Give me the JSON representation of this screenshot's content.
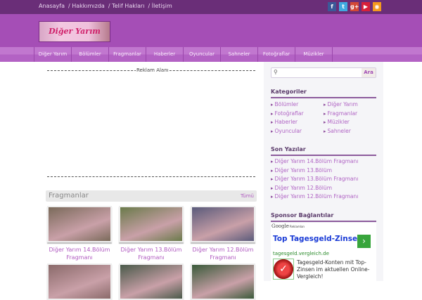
{
  "topbar": {
    "links": [
      "Anasayfa",
      "/ Hakkımızda",
      "/ Telif Hakları",
      "/ İletişim"
    ],
    "social": [
      {
        "icon": "facebook-icon",
        "glyph": "f",
        "color": "#3b5998"
      },
      {
        "icon": "twitter-icon",
        "glyph": "t",
        "color": "#3fa9e0"
      },
      {
        "icon": "google-plus-icon",
        "glyph": "g+",
        "color": "#d34836"
      },
      {
        "icon": "youtube-icon",
        "glyph": "▶",
        "color": "#d8203a"
      },
      {
        "icon": "rss-icon",
        "glyph": "◉",
        "color": "#f39a1e"
      }
    ]
  },
  "logo": "Diğer Yarım",
  "nav": [
    "Diğer Yarım",
    "Bölümler",
    "Fragmanlar",
    "Haberler",
    "Oyuncular",
    "Sahneler",
    "Fotoğraflar",
    "Müzikler"
  ],
  "main": {
    "ad_label": "Reklam Alanı",
    "section_title": "Fragmanlar",
    "see_all": "Tümü",
    "cards": [
      {
        "title": "Diğer Yarım 14.Bölüm Fragmanı",
        "color": "#7a6a5a"
      },
      {
        "title": "Diğer Yarım 13.Bölüm Fragmanı",
        "color": "#6a7a4a"
      },
      {
        "title": "Diğer Yarım 12.Bölüm Fragmanı",
        "color": "#5a5a7a"
      },
      {
        "title": "",
        "color": "#8a6a6a"
      },
      {
        "title": "",
        "color": "#4a5a4a"
      },
      {
        "title": "",
        "color": "#3a5a3a"
      }
    ]
  },
  "sidebar": {
    "search_placeholder": "",
    "search_button": "Ara",
    "categories_title": "Kategoriler",
    "categories": [
      "Bölümler",
      "Diğer Yarım",
      "Fotoğraflar",
      "Fragmanlar",
      "Haberler",
      "Müzikler",
      "Oyuncular",
      "Sahneler"
    ],
    "recent_title": "Son Yazılar",
    "recent": [
      "Diğer Yarım 14.Bölüm Fragmanı",
      "Diğer Yarım 13.Bölüm",
      "Diğer Yarım 13.Bölüm Fragmanı",
      "Diğer Yarım 12.Bölüm",
      "Diğer Yarım 12.Bölüm Fragmanı"
    ],
    "sponsor_title": "Sponsor Bağlantılar",
    "ad": {
      "google": "Google",
      "google_suffix": "Reklamları",
      "headline": "Top Tagesgeld-Zinsen",
      "url": "tagesgeld.vergleich.de",
      "text": "Tagesgeld-Konten mit Top-Zinsen im aktuellen Online-Vergleich!",
      "arrow": "›"
    }
  }
}
